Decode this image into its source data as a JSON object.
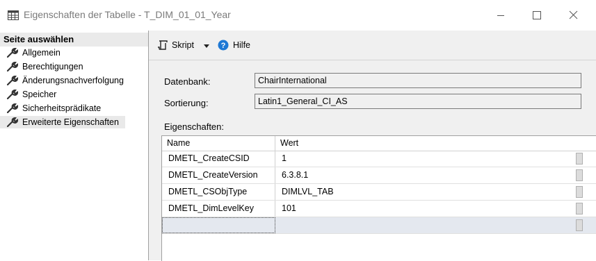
{
  "window": {
    "title": "Eigenschaften der Tabelle - T_DIM_01_01_Year"
  },
  "sidebar": {
    "header": "Seite auswählen",
    "items": [
      {
        "label": "Allgemein"
      },
      {
        "label": "Berechtigungen"
      },
      {
        "label": "Änderungsnachverfolgung"
      },
      {
        "label": "Speicher"
      },
      {
        "label": "Sicherheitsprädikate"
      },
      {
        "label": "Erweiterte Eigenschaften",
        "selected": true
      }
    ]
  },
  "toolbar": {
    "script_label": "Skript",
    "help_label": "Hilfe"
  },
  "form": {
    "database_label": "Datenbank:",
    "database_value": "ChairInternational",
    "collation_label": "Sortierung:",
    "collation_value": "Latin1_General_CI_AS",
    "properties_label": "Eigenschaften:"
  },
  "grid": {
    "columns": [
      "Name",
      "Wert"
    ],
    "rows": [
      {
        "name": "DMETL_CreateCSID",
        "value": "1"
      },
      {
        "name": "DMETL_CreateVersion",
        "value": "6.3.8.1"
      },
      {
        "name": "DMETL_CSObjType",
        "value": "DIMLVL_TAB"
      },
      {
        "name": "DMETL_DimLevelKey",
        "value": "101"
      }
    ]
  },
  "colors": {
    "selected_item_bg": "#e9e9e9",
    "new_row_bg": "#e4e8ef",
    "help_icon": "#1e78d4"
  },
  "icons": {
    "title": "table-icon",
    "sidebar_item": "wrench-icon",
    "script": "script-icon",
    "dropdown": "chevron-down-icon",
    "help": "help-icon"
  }
}
